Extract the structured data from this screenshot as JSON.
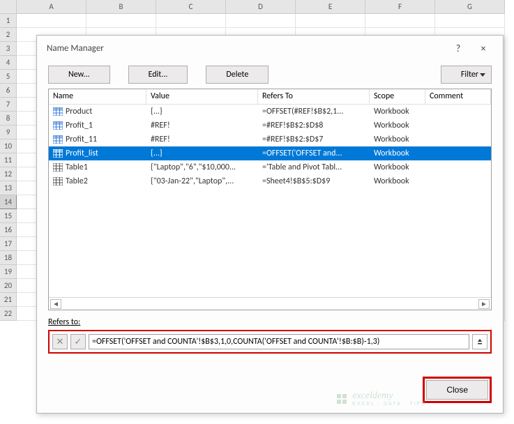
{
  "sheet": {
    "columns": [
      "A",
      "B",
      "C",
      "D",
      "E",
      "F",
      "G"
    ],
    "rows": [
      "1",
      "2",
      "3",
      "4",
      "5",
      "6",
      "7",
      "8",
      "9",
      "10",
      "11",
      "12",
      "13",
      "14",
      "15",
      "16",
      "17",
      "18",
      "19",
      "20",
      "21",
      "22"
    ],
    "selected_row": "14"
  },
  "dialog": {
    "title": "Name Manager",
    "help_char": "?",
    "close_char": "×",
    "buttons": {
      "new": "New...",
      "edit": "Edit...",
      "delete": "Delete",
      "filter": "Filter"
    },
    "headers": {
      "name": "Name",
      "value": "Value",
      "refers": "Refers To",
      "scope": "Scope",
      "comment": "Comment"
    },
    "rows": [
      {
        "icon": "range",
        "name": "Product",
        "value": "{...}",
        "refers": "=OFFSET(#REF!$B$2,1...",
        "scope": "Workbook",
        "comment": ""
      },
      {
        "icon": "range",
        "name": "Profit_1",
        "value": "#REF!",
        "refers": "=#REF!$B$2:$D$8",
        "scope": "Workbook",
        "comment": ""
      },
      {
        "icon": "range",
        "name": "Profit_11",
        "value": "#REF!",
        "refers": "=#REF!$B$2:$D$7",
        "scope": "Workbook",
        "comment": ""
      },
      {
        "icon": "range",
        "name": "Profit_list",
        "value": "{...}",
        "refers": "=OFFSET('OFFSET and...",
        "scope": "Workbook",
        "comment": "",
        "selected": true
      },
      {
        "icon": "table",
        "name": "Table1",
        "value": "{\"Laptop\",\"6\",\"$10,000...",
        "refers": "='Table and Pivot Tabl...",
        "scope": "Workbook",
        "comment": ""
      },
      {
        "icon": "table",
        "name": "Table2",
        "value": "{\"03-Jan-22\",\"Laptop\",...",
        "refers": "=Sheet4!$B$5:$D$9",
        "scope": "Workbook",
        "comment": ""
      }
    ],
    "refers_to_label": "Refers to:",
    "refers_to_value": "=OFFSET('OFFSET and COUNTA'!$B$3,1,0,COUNTA('OFFSET and COUNTA'!$B:$B)-1,3)",
    "close_label": "Close"
  },
  "watermark": {
    "text": "exceldemy",
    "sub": "EXCEL · DATA · TIPS"
  }
}
